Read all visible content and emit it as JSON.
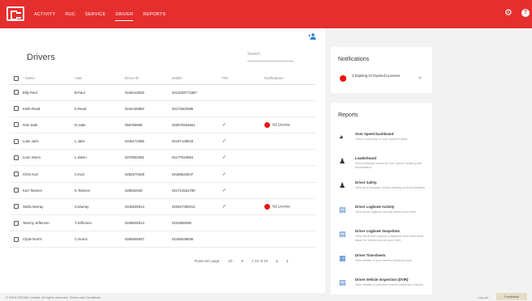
{
  "nav": [
    "ACTIVITY",
    "RUC",
    "SERVICE",
    "DRIVER",
    "REPORTS"
  ],
  "drivers": {
    "title": "Drivers",
    "search_placeholder": "Search",
    "columns": [
      "Name",
      "Alias",
      "Driver ID",
      "Mobile",
      "PIN",
      "Notifications"
    ],
    "rows": [
      {
        "name": "Billy Paul",
        "alias": "B.Paul",
        "id": "0246413026",
        "mobile": "0211003771687",
        "pin": "",
        "notif": ""
      },
      {
        "name": "Keith Read",
        "alias": "K.Read",
        "id": "0244420982",
        "mobile": "02172503385",
        "pin": "",
        "notif": ""
      },
      {
        "name": "Rob Jade",
        "alias": "R.Jade",
        "id": "056789099",
        "mobile": "022879334651",
        "pin": "✓",
        "notif": "NZ License"
      },
      {
        "name": "Luke Jaris",
        "alias": "L.Jaris",
        "id": "0245172385",
        "mobile": "02157129043",
        "pin": "✓",
        "notif": ""
      },
      {
        "name": "Leon Steen",
        "alias": "L.Steen",
        "id": "0270933391",
        "mobile": "02177610894",
        "pin": "✓",
        "notif": ""
      },
      {
        "name": "Chris Kuti",
        "alias": "C.Kuti",
        "id": "0252570339",
        "mobile": "02188634647",
        "pin": "✓",
        "notif": ""
      },
      {
        "name": "Kurt Tamsen",
        "alias": "K.Tamsen",
        "id": "029662049",
        "mobile": "021714531780",
        "pin": "✓",
        "notif": ""
      },
      {
        "name": "Stella Murray",
        "alias": "S.Murray",
        "id": "0240639314",
        "mobile": "022827390313",
        "pin": "✓",
        "notif": "NZ License"
      },
      {
        "name": "Tammy Jefferson",
        "alias": "T.Jefferson",
        "id": "0248639314",
        "mobile": "0222858298",
        "pin": "",
        "notif": ""
      },
      {
        "name": "Clyde Norris",
        "alias": "C.Norris",
        "id": "0266946937",
        "mobile": "02185636836",
        "pin": "",
        "notif": ""
      }
    ],
    "pager": {
      "label": "Rows per page:",
      "rows": "10",
      "range": "1-10 of 10"
    }
  },
  "notifications": {
    "title": "Notifications",
    "item": "2 Expiring Or Expired Licenses"
  },
  "reports": {
    "title": "Reports",
    "items": [
      {
        "t": "Over Speed Dashboard",
        "d": "View a summary of over speed events"
      },
      {
        "t": "Leaderboard",
        "d": "View rankings based on over speed, braking and acceleration"
      },
      {
        "t": "Driver Safety",
        "d": "View and compare drivers braking and acceleration"
      },
      {
        "t": "Driver Logbook Activity",
        "d": "View driver logbook activity across your fleet"
      },
      {
        "t": "Driver Logbook Snapshots",
        "d": "View electronic logbook snapshots that have been taken for drivers across your fleet"
      },
      {
        "t": "Driver Timesheets",
        "d": "View details of your drivers working hours"
      },
      {
        "t": "Driver Vehicle Inspection (DVIR)",
        "d": "View details of previous vehicle inspection checks"
      }
    ]
  },
  "footer": {
    "copyright": "© 2016 EROAD Limited. All rights reserved.   Terms and Conditions",
    "logout": "Log out",
    "feedback": "Feedback"
  }
}
